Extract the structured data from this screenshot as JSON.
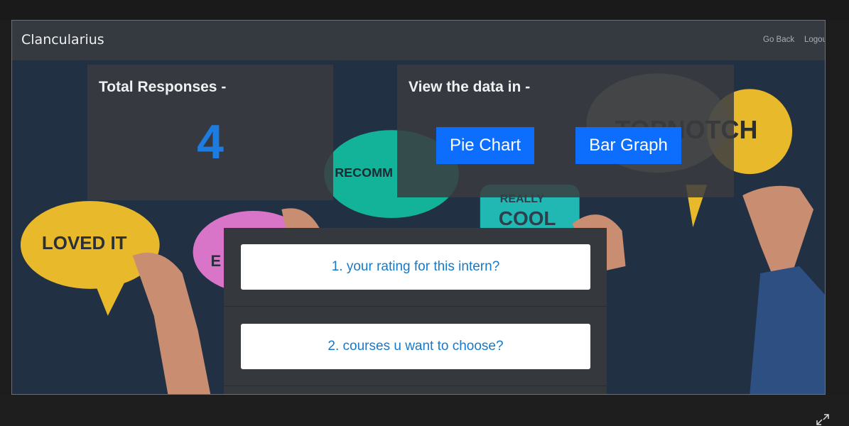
{
  "navbar": {
    "brand": "Clancularius",
    "go_back": "Go Back",
    "logout": "Logout"
  },
  "responses": {
    "title": "Total Responses -",
    "count": "4"
  },
  "view": {
    "title": "View the data in -",
    "pie_label": "Pie Chart",
    "bar_label": "Bar Graph"
  },
  "questions": [
    "1. your rating for this intern?",
    "2. courses u want to choose?"
  ],
  "background_bubbles": {
    "loved": "LOVED IT",
    "recommend": "RECOMM",
    "really": "REALLY",
    "cool": "COOL",
    "topnotch": "TOPNOTCH",
    "e_letter": "E"
  },
  "colors": {
    "navbar": "#353a40",
    "accent": "#0d6efd",
    "count": "#1d7ce0",
    "question_text": "#1779c9"
  },
  "icons": {
    "expand": "expand-arrows-icon"
  }
}
